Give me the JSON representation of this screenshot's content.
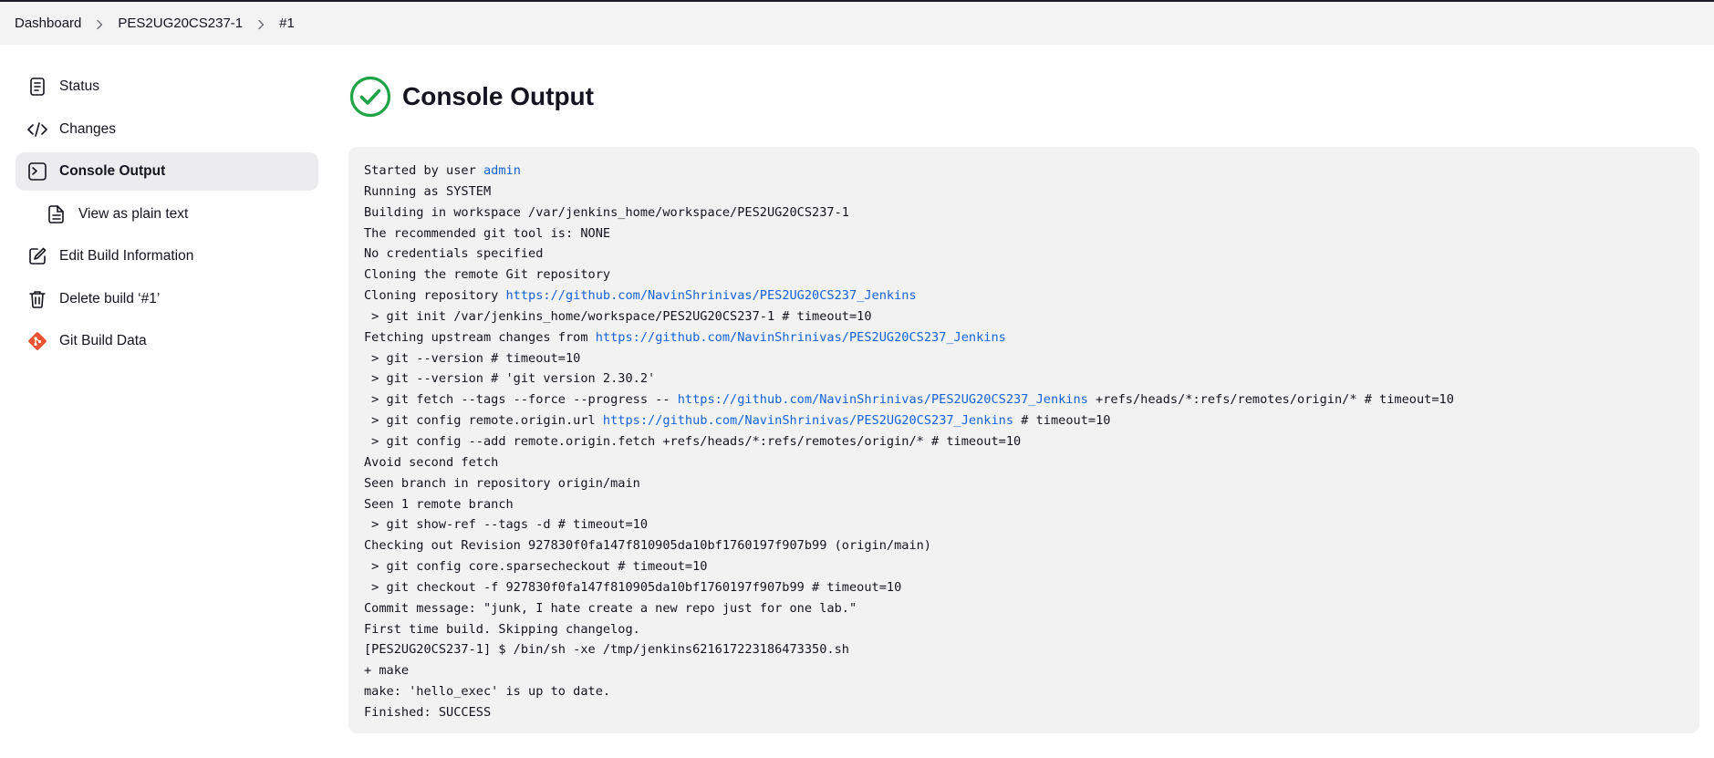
{
  "breadcrumb": {
    "items": [
      "Dashboard",
      "PES2UG20CS237-1",
      "#1"
    ]
  },
  "sidebar": {
    "items": [
      {
        "label": "Status",
        "icon": "document-icon"
      },
      {
        "label": "Changes",
        "icon": "code-icon"
      },
      {
        "label": "Console Output",
        "icon": "terminal-icon",
        "active": true
      },
      {
        "label": "View as plain text",
        "icon": "file-icon"
      },
      {
        "label": "Edit Build Information",
        "icon": "edit-icon"
      },
      {
        "label": "Delete build ‘#1’",
        "icon": "trash-icon"
      },
      {
        "label": "Git Build Data",
        "icon": "git-icon"
      }
    ]
  },
  "page": {
    "title": "Console Output",
    "status_icon": "success-check-icon"
  },
  "colors": {
    "success": "#1ea446",
    "link": "#1363d8",
    "git": "#f05133",
    "console_bg": "#f2f2f2",
    "active_bg": "#ececef"
  },
  "console": {
    "lines": [
      {
        "pre": "Started by user ",
        "link": "admin",
        "post": ""
      },
      {
        "text": "Running as SYSTEM"
      },
      {
        "text": "Building in workspace /var/jenkins_home/workspace/PES2UG20CS237-1"
      },
      {
        "text": "The recommended git tool is: NONE"
      },
      {
        "text": "No credentials specified"
      },
      {
        "text": "Cloning the remote Git repository"
      },
      {
        "pre": "Cloning repository ",
        "link": "https://github.com/NavinShrinivas/PES2UG20CS237_Jenkins",
        "post": ""
      },
      {
        "text": " > git init /var/jenkins_home/workspace/PES2UG20CS237-1 # timeout=10"
      },
      {
        "pre": "Fetching upstream changes from ",
        "link": "https://github.com/NavinShrinivas/PES2UG20CS237_Jenkins",
        "post": ""
      },
      {
        "text": " > git --version # timeout=10"
      },
      {
        "text": " > git --version # 'git version 2.30.2'"
      },
      {
        "pre": " > git fetch --tags --force --progress -- ",
        "link": "https://github.com/NavinShrinivas/PES2UG20CS237_Jenkins",
        "post": " +refs/heads/*:refs/remotes/origin/* # timeout=10"
      },
      {
        "pre": " > git config remote.origin.url ",
        "link": "https://github.com/NavinShrinivas/PES2UG20CS237_Jenkins",
        "post": " # timeout=10"
      },
      {
        "text": " > git config --add remote.origin.fetch +refs/heads/*:refs/remotes/origin/* # timeout=10"
      },
      {
        "text": "Avoid second fetch"
      },
      {
        "text": "Seen branch in repository origin/main"
      },
      {
        "text": "Seen 1 remote branch"
      },
      {
        "text": " > git show-ref --tags -d # timeout=10"
      },
      {
        "text": "Checking out Revision 927830f0fa147f810905da10bf1760197f907b99 (origin/main)"
      },
      {
        "text": " > git config core.sparsecheckout # timeout=10"
      },
      {
        "text": " > git checkout -f 927830f0fa147f810905da10bf1760197f907b99 # timeout=10"
      },
      {
        "text": "Commit message: \"junk, I hate create a new repo just for one lab.\""
      },
      {
        "text": "First time build. Skipping changelog."
      },
      {
        "text": "[PES2UG20CS237-1] $ /bin/sh -xe /tmp/jenkins621617223186473350.sh"
      },
      {
        "text": "+ make"
      },
      {
        "text": "make: 'hello_exec' is up to date."
      },
      {
        "text": "Finished: SUCCESS"
      }
    ]
  }
}
